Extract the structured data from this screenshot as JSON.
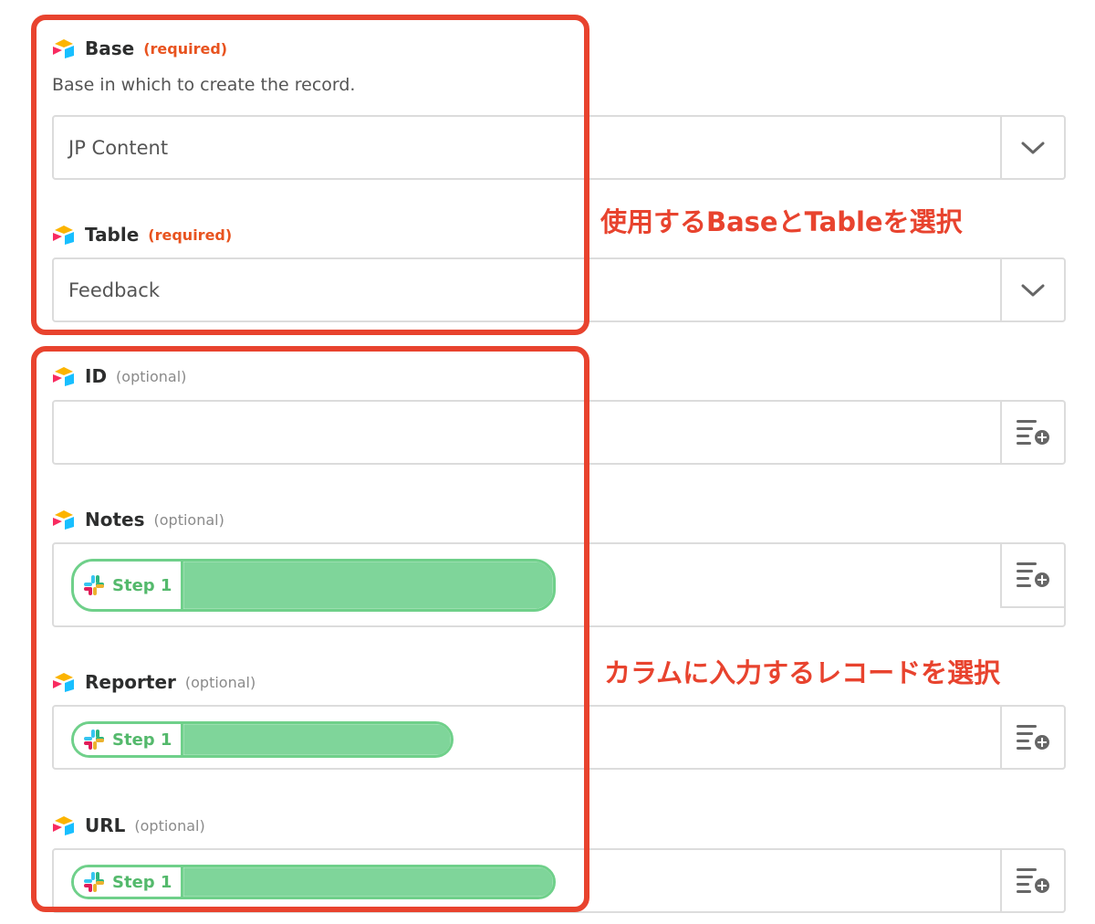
{
  "fields": {
    "base": {
      "name": "Base",
      "tag": "(required)",
      "description": "Base in which to create the record.",
      "value": "JP Content"
    },
    "table": {
      "name": "Table",
      "tag": "(required)",
      "value": "Feedback"
    },
    "id": {
      "name": "ID",
      "tag": "(optional)",
      "value": ""
    },
    "notes": {
      "name": "Notes",
      "tag": "(optional)",
      "pill_label": "Step 1"
    },
    "reporter": {
      "name": "Reporter",
      "tag": "(optional)",
      "pill_label": "Step 1"
    },
    "url": {
      "name": "URL",
      "tag": "(optional)",
      "pill_label": "Step 1"
    }
  },
  "annotations": {
    "select_base_table": "使用するBaseとTableを選択",
    "select_record": "カラムに入力するレコードを選択"
  },
  "icons": {
    "field": "airtable-icon",
    "dropdown": "chevron-down-icon",
    "insert": "insert-data-icon",
    "pill": "slack-icon"
  },
  "colors": {
    "annotation": "#e8432e",
    "required": "#e8531f",
    "pill_border": "#6fd08a",
    "pill_text": "#54b96c"
  }
}
